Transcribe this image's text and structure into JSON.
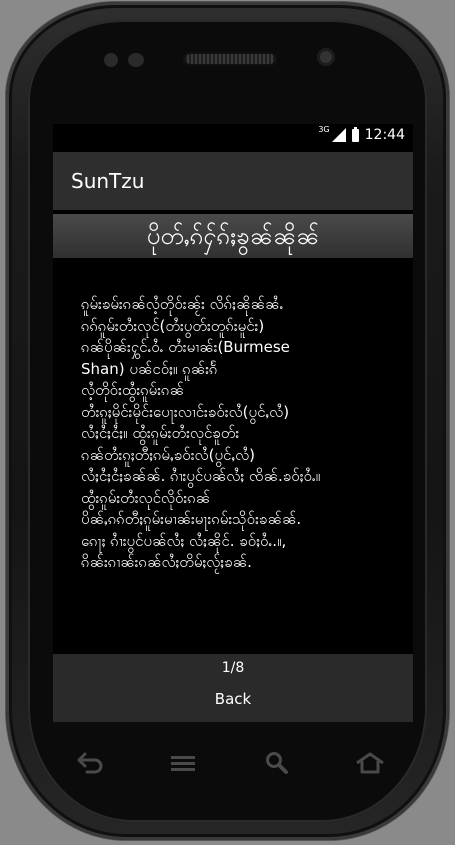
{
  "status_bar": {
    "network": "3G",
    "time": "12:44"
  },
  "app": {
    "title": "SunTzu"
  },
  "chapter": {
    "title": "ပိုတ်ႇၵ်ႁ်ၵ်ႈၶွၼ်ၼိုၼ်"
  },
  "content": {
    "text": "ၵူမ်းၶမ်းၵၼ်လႆ့တိုဝ်းၼႂ်း လိၵ်ႈၼိုၼ်ၼႆႉ\nၵၵ်ၵူမ်းတႆးလုင်(တႆးပွတ်းတူၵ်းမူင်း)\nၵၼ်ပိုၼ်းႁွင်ႉဝႆႉ တႆးမၢၼ်း(Burmese\nShan) ပၼ်ငဝ်ႈ။ ၵူၼ်းၵႅ\nလႆ့တိုဝ်းထွႆးၵူမ်းၵၼ်\nတႆးၵူႈမိုင်းမိုင်းပေႃးလၢင်းၶဝ်းလႆ(ပွင်ႇလႆ)\nလႆႈငႆႈငႆႈ။ ထွႆးၵူမ်းတႆးလုင်ၶူတ်း\nၵၼ်တႆးၵူႈတီႈၵမ်ႇၶဝ်းလႆ(ပွင်ႇလႆ)\nလႆႈငႆႈငႆႈၶၼ်ၼ်. ၵၢႆးပွင်ပၼ်လႆႈ ၸိၼ်.ၶဝ်ႈဝႆႉ။\nထွႆးၵူမ်းတႆးလုင်လိုဝ်းၵၼ်\nပိၼ်ႇၵၵ်တီႈၵူမ်းမၢၼ်းမႃးၵမ်းသိုဝ်းၶၼ်ၼ်.\nၵေႃႈ ၵၢႆးပွင်ပၼ်လႆႈ လႆႈၼိုင်. ၶဝ်ႈဝႆႉ.။,\nၵိၼ်းၵၢၼ်းၵၼ်လႆႈတိမ်ႈလႂ်ႈၶၼ်."
  },
  "footer": {
    "page_indicator": "1/8",
    "back_label": "Back"
  }
}
